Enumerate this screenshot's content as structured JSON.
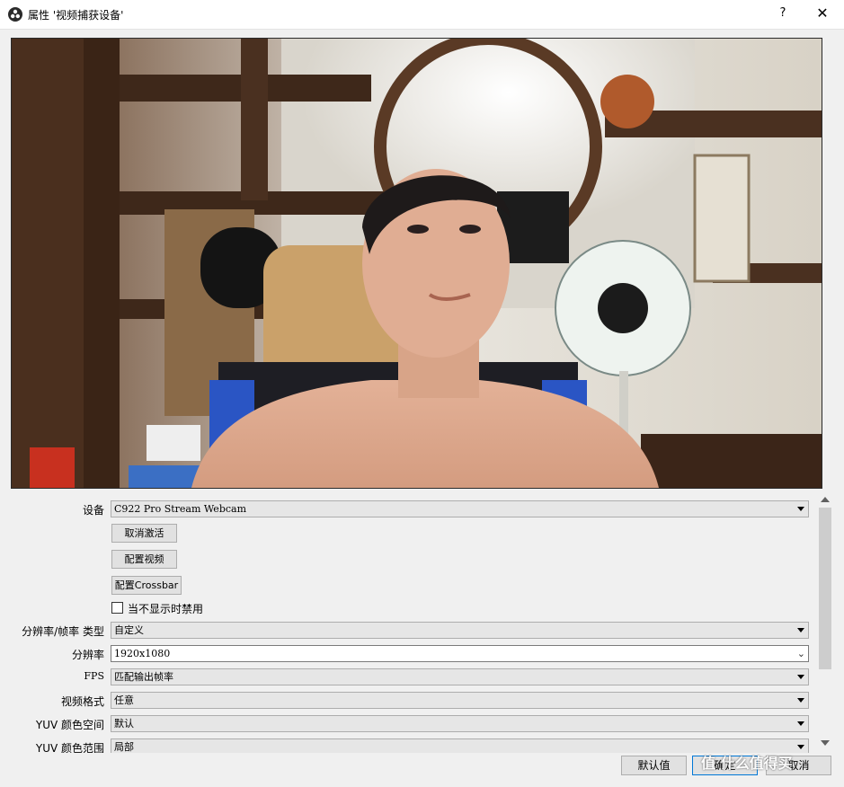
{
  "window": {
    "title": "属性 '视频捕获设备'",
    "help_label": "?",
    "close_label": "✕"
  },
  "preview": {
    "label": "Camera preview"
  },
  "properties": {
    "device": {
      "label": "设备",
      "value": "C922 Pro Stream Webcam"
    },
    "deactivate_button": "取消激活",
    "configure_video_button": "配置视频",
    "configure_crossbar_button": "配置Crossbar",
    "deactivate_when_hidden": {
      "label": "当不显示时禁用",
      "checked": false
    },
    "res_fps_type": {
      "label": "分辨率/帧率 类型",
      "value": "自定义"
    },
    "resolution": {
      "label": "分辨率",
      "value": "1920x1080"
    },
    "fps": {
      "label": "FPS",
      "value": "匹配输出帧率"
    },
    "video_format": {
      "label": "视频格式",
      "value": "任意"
    },
    "yuv_color_space": {
      "label": "YUV 颜色空间",
      "value": "默认"
    },
    "yuv_color_range": {
      "label": "YUV 颜色范围",
      "value": "局部"
    }
  },
  "footer": {
    "defaults_button": "默认值",
    "ok_button": "确定",
    "cancel_button": "取消"
  },
  "watermark": "值 什么值得买"
}
